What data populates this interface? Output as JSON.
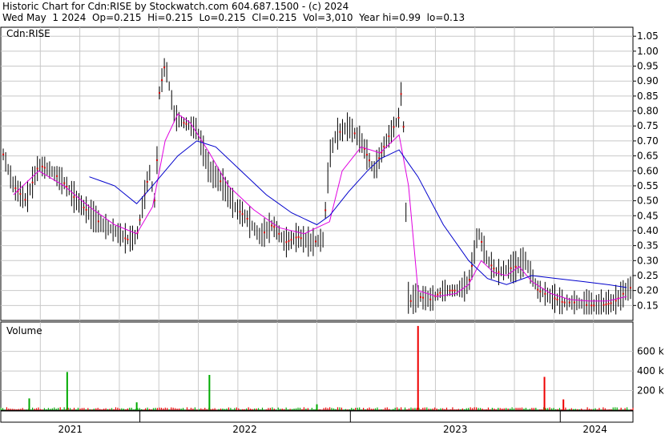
{
  "header": {
    "line1": "Historic Chart for Cdn:RISE by Stockwatch.com 604.687.1500 - (c) 2024",
    "line2": "Wed May  1 2024  Op=0.215  Hi=0.215  Lo=0.215  Cl=0.215  Vol=3,010  Year hi=0.99  lo=0.13"
  },
  "colors": {
    "price_bar": "#000000",
    "ma_fast": "#e000e0",
    "ma_slow": "#0000cc",
    "down_tick": "#dd0000",
    "vol_up": "#00aa00",
    "vol_down": "#ee0000",
    "grid": "#c8c8c8",
    "year_divider": "#000000"
  },
  "chart_data": [
    {
      "type": "line",
      "panel": "price",
      "legend": "Cdn:RISE",
      "ylim": [
        0.1,
        1.08
      ],
      "y_ticks": [
        "1.05",
        "1.00",
        "0.95",
        "0.90",
        "0.85",
        "0.80",
        "0.75",
        "0.70",
        "0.65",
        "0.60",
        "0.55",
        "0.50",
        "0.45",
        "0.40",
        "0.35",
        "0.30",
        "0.25",
        "0.20",
        "0.15"
      ],
      "x_labels": [
        "2021",
        "2022",
        "2023",
        "2024"
      ],
      "grid": true,
      "series": [
        {
          "name": "price",
          "t": [
            0,
            0.02,
            0.04,
            0.06,
            0.08,
            0.1,
            0.12,
            0.14,
            0.16,
            0.18,
            0.2,
            0.215,
            0.235,
            0.245,
            0.25,
            0.26,
            0.275,
            0.29,
            0.31,
            0.33,
            0.35,
            0.37,
            0.39,
            0.41,
            0.43,
            0.45,
            0.47,
            0.49,
            0.51,
            0.52,
            0.53,
            0.55,
            0.57,
            0.59,
            0.61,
            0.63,
            0.635,
            0.645,
            0.66,
            0.68,
            0.7,
            0.72,
            0.74,
            0.755,
            0.77,
            0.785,
            0.8,
            0.815,
            0.83,
            0.85,
            0.87,
            0.89,
            0.91,
            0.93,
            0.95,
            0.97,
            0.99,
            1.0
          ],
          "values": [
            0.68,
            0.55,
            0.5,
            0.62,
            0.6,
            0.56,
            0.5,
            0.46,
            0.42,
            0.4,
            0.37,
            0.38,
            0.6,
            0.48,
            0.85,
            0.96,
            0.78,
            0.76,
            0.74,
            0.6,
            0.56,
            0.48,
            0.44,
            0.38,
            0.42,
            0.36,
            0.38,
            0.36,
            0.37,
            0.65,
            0.72,
            0.75,
            0.7,
            0.6,
            0.7,
            0.78,
            0.9,
            0.16,
            0.18,
            0.17,
            0.2,
            0.2,
            0.22,
            0.4,
            0.3,
            0.26,
            0.27,
            0.28,
            0.3,
            0.2,
            0.18,
            0.16,
            0.16,
            0.15,
            0.15,
            0.16,
            0.2,
            0.215
          ]
        },
        {
          "name": "MA fast",
          "t": [
            0.02,
            0.06,
            0.1,
            0.14,
            0.18,
            0.215,
            0.24,
            0.26,
            0.28,
            0.3,
            0.33,
            0.36,
            0.4,
            0.44,
            0.48,
            0.52,
            0.54,
            0.57,
            0.6,
            0.63,
            0.645,
            0.66,
            0.69,
            0.72,
            0.74,
            0.76,
            0.78,
            0.8,
            0.82,
            0.84,
            0.87,
            0.9,
            0.93,
            0.96,
            0.99
          ],
          "values": [
            0.52,
            0.6,
            0.55,
            0.48,
            0.42,
            0.39,
            0.48,
            0.7,
            0.79,
            0.76,
            0.66,
            0.55,
            0.47,
            0.41,
            0.39,
            0.43,
            0.6,
            0.68,
            0.66,
            0.72,
            0.55,
            0.2,
            0.18,
            0.19,
            0.22,
            0.3,
            0.26,
            0.25,
            0.28,
            0.23,
            0.19,
            0.17,
            0.165,
            0.165,
            0.18
          ]
        },
        {
          "name": "MA slow",
          "t": [
            0.14,
            0.18,
            0.215,
            0.24,
            0.28,
            0.31,
            0.34,
            0.38,
            0.42,
            0.46,
            0.5,
            0.52,
            0.55,
            0.58,
            0.6,
            0.63,
            0.66,
            0.7,
            0.74,
            0.77,
            0.8,
            0.84,
            0.88,
            0.92,
            0.96,
            0.99
          ],
          "values": [
            0.58,
            0.55,
            0.49,
            0.55,
            0.65,
            0.7,
            0.68,
            0.6,
            0.52,
            0.46,
            0.42,
            0.45,
            0.53,
            0.6,
            0.64,
            0.67,
            0.58,
            0.42,
            0.3,
            0.24,
            0.22,
            0.25,
            0.24,
            0.23,
            0.22,
            0.21
          ]
        }
      ]
    },
    {
      "type": "bar",
      "panel": "volume",
      "legend": "Volume",
      "ylim": [
        0,
        900
      ],
      "y_ticks": [
        "600 k",
        "400 k",
        "200 k"
      ],
      "series": [
        {
          "name": "volume spikes",
          "t": [
            0.045,
            0.105,
            0.215,
            0.33,
            0.5,
            0.66,
            0.86,
            0.89
          ],
          "values": [
            120,
            390,
            80,
            360,
            60,
            860,
            340,
            110
          ]
        }
      ]
    }
  ]
}
